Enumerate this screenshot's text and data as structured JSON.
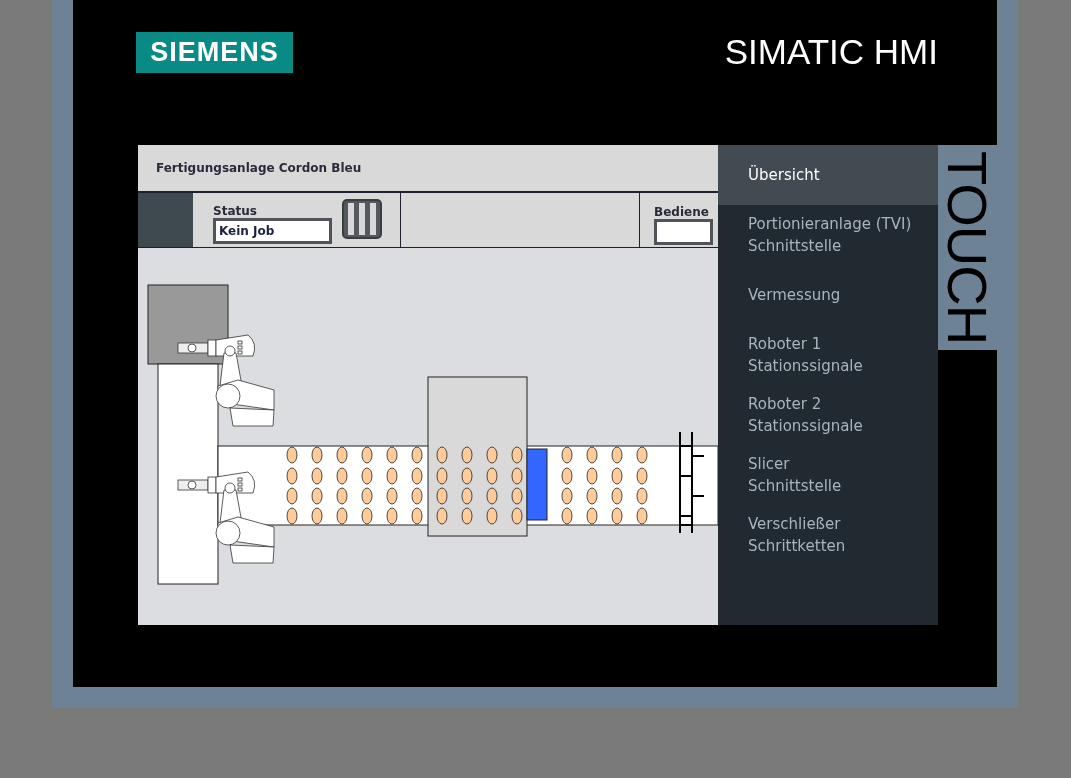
{
  "device": {
    "brand": "SIEMENS",
    "product": "SIMATIC HMI",
    "badge": "TOUCH"
  },
  "screen": {
    "title": "Fertigungsanlage Cordon Bleu",
    "status": {
      "label": "Status",
      "value": "Kein Job"
    },
    "operator": {
      "label": "Bediene"
    }
  },
  "menu": [
    {
      "lines": [
        "Übersicht"
      ],
      "selected": true
    },
    {
      "lines": [
        "Portionieranlage (TVI)",
        "Schnittstelle"
      ],
      "selected": false
    },
    {
      "lines": [
        "Vermessung"
      ],
      "selected": false
    },
    {
      "lines": [
        "Roboter 1",
        "Stationssignale"
      ],
      "selected": false
    },
    {
      "lines": [
        "Roboter 2",
        "Stationssignale"
      ],
      "selected": false
    },
    {
      "lines": [
        "Slicer",
        "Schnittstelle"
      ],
      "selected": false
    },
    {
      "lines": [
        "Verschließer",
        "Schrittketten"
      ],
      "selected": false
    }
  ]
}
